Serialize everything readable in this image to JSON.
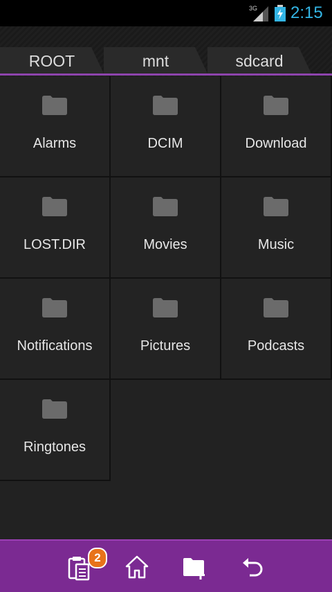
{
  "status_bar": {
    "network_label": "3G",
    "time": "2:15",
    "time_color": "#33b5e5",
    "signal_icon": "signal-icon",
    "battery_icon": "battery-charging-icon"
  },
  "breadcrumbs": [
    {
      "label": "ROOT"
    },
    {
      "label": "mnt"
    },
    {
      "label": "sdcard"
    }
  ],
  "accent_color": "#8e44ad",
  "folders": [
    {
      "name": "Alarms",
      "icon": "folder-icon"
    },
    {
      "name": "DCIM",
      "icon": "folder-icon"
    },
    {
      "name": "Download",
      "icon": "folder-icon"
    },
    {
      "name": "LOST.DIR",
      "icon": "folder-icon"
    },
    {
      "name": "Movies",
      "icon": "folder-icon"
    },
    {
      "name": "Music",
      "icon": "folder-icon"
    },
    {
      "name": "Notifications",
      "icon": "folder-icon"
    },
    {
      "name": "Pictures",
      "icon": "folder-icon"
    },
    {
      "name": "Podcasts",
      "icon": "folder-icon"
    },
    {
      "name": "Ringtones",
      "icon": "folder-icon"
    }
  ],
  "bottom_bar": {
    "background": "#7b2a92",
    "clipboard_badge": "2",
    "buttons": [
      {
        "name": "clipboard-button",
        "icon": "clipboard-icon"
      },
      {
        "name": "home-button",
        "icon": "home-icon"
      },
      {
        "name": "new-folder-button",
        "icon": "folder-add-icon"
      },
      {
        "name": "undo-button",
        "icon": "undo-icon"
      }
    ]
  }
}
